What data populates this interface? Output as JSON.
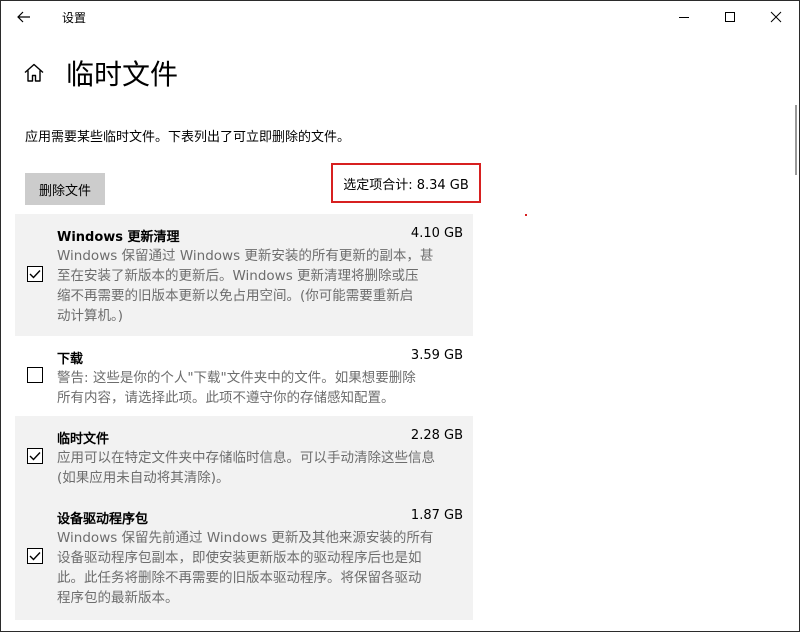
{
  "window": {
    "title": "设置"
  },
  "header": {
    "page_title": "临时文件"
  },
  "description": "应用需要某些临时文件。下表列出了可立即删除的文件。",
  "toolbar": {
    "delete_label": "删除文件",
    "total_label": "选定项合计: 8.34 GB"
  },
  "colors": {
    "highlight_border": "#d72020",
    "selected_row": "#f2f2f2",
    "button_bg": "#cccccc",
    "description_text": "#6d6d6d"
  },
  "items": [
    {
      "name": "Windows 更新清理",
      "size": "4.10 GB",
      "checked": true,
      "lines": [
        "Windows 保留通过 Windows 更新安装的所有更新的副本，甚",
        "至在安装了新版本的更新后。Windows 更新清理将删除或压",
        "缩不再需要的旧版本更新以免占用空间。(你可能需要重新启",
        "动计算机。)"
      ]
    },
    {
      "name": "下载",
      "size": "3.59 GB",
      "checked": false,
      "lines": [
        "警告: 这些是你的个人\"下载\"文件夹中的文件。如果想要删除",
        "所有内容，请选择此项。此项不遵守你的存储感知配置。"
      ]
    },
    {
      "name": "临时文件",
      "size": "2.28 GB",
      "checked": true,
      "lines": [
        "应用可以在特定文件夹中存储临时信息。可以手动清除这些信息",
        "(如果应用未自动将其清除)。"
      ]
    },
    {
      "name": "设备驱动程序包",
      "size": "1.87 GB",
      "checked": true,
      "lines": [
        "Windows 保留先前通过 Windows 更新及其他来源安装的所有",
        "设备驱动程序包副本，即使安装更新版本的驱动程序后也是如",
        "此。此任务将删除不再需要的旧版本驱动程序。将保留各驱动",
        "程序包的最新版本。"
      ]
    }
  ]
}
